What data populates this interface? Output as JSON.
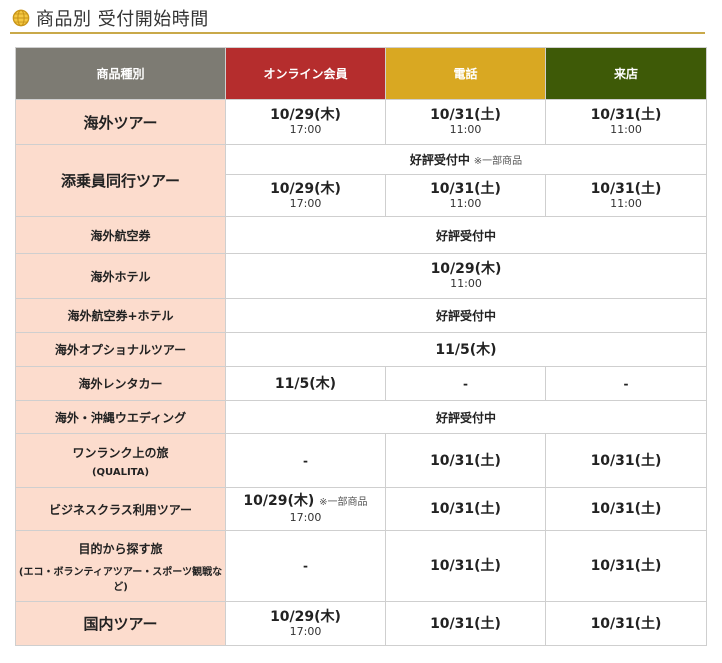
{
  "page": {
    "title": "商品別 受付開始時間"
  },
  "header": {
    "category": "商品種別",
    "online": "オンライン会員",
    "phone": "電話",
    "store": "来店"
  },
  "colors": {
    "category": "#7d7b73",
    "online": "#b52d2d",
    "phone": "#d9a822",
    "store": "#3e5a07",
    "row_label": "#fcdccd",
    "title_rule": "#c9a94a"
  },
  "rows": {
    "overseas_tour": {
      "label": "海外ツアー",
      "online_date": "10/29(木)",
      "online_time": "17:00",
      "phone_date": "10/31(土)",
      "phone_time": "11:00",
      "store_date": "10/31(土)",
      "store_time": "11:00"
    },
    "escorted_tour": {
      "label": "添乗員同行ツアー",
      "notice": "好評受付中",
      "notice_note": "※一部商品",
      "online_date": "10/29(木)",
      "online_time": "17:00",
      "phone_date": "10/31(土)",
      "phone_time": "11:00",
      "store_date": "10/31(土)",
      "store_time": "11:00"
    },
    "air_ticket": {
      "label": "海外航空券",
      "value": "好評受付中"
    },
    "hotel": {
      "label": "海外ホテル",
      "date": "10/29(木)",
      "time": "11:00"
    },
    "air_hotel": {
      "label": "海外航空券+ホテル",
      "value": "好評受付中"
    },
    "optional_tour": {
      "label": "海外オプショナルツアー",
      "value": "11/5(木)"
    },
    "rental_car": {
      "label": "海外レンタカー",
      "online": "11/5(木)",
      "phone": "-",
      "store": "-"
    },
    "wedding": {
      "label": "海外・沖縄ウエディング",
      "value": "好評受付中"
    },
    "qualita": {
      "label": "ワンランク上の旅",
      "sub": "(QUALITA)",
      "online": "-",
      "phone": "10/31(土)",
      "store": "10/31(土)"
    },
    "business_class": {
      "label": "ビジネスクラス利用ツアー",
      "online_date": "10/29(木)",
      "online_note": "※一部商品",
      "online_time": "17:00",
      "phone": "10/31(土)",
      "store": "10/31(土)"
    },
    "purpose_tour": {
      "label": "目的から探す旅",
      "sub": "(エコ・ボランティアツアー・スポーツ観戦など)",
      "online": "-",
      "phone": "10/31(土)",
      "store": "10/31(土)"
    },
    "domestic_tour": {
      "label": "国内ツアー",
      "online_date": "10/29(木)",
      "online_time": "17:00",
      "phone": "10/31(土)",
      "store": "10/31(土)"
    }
  }
}
